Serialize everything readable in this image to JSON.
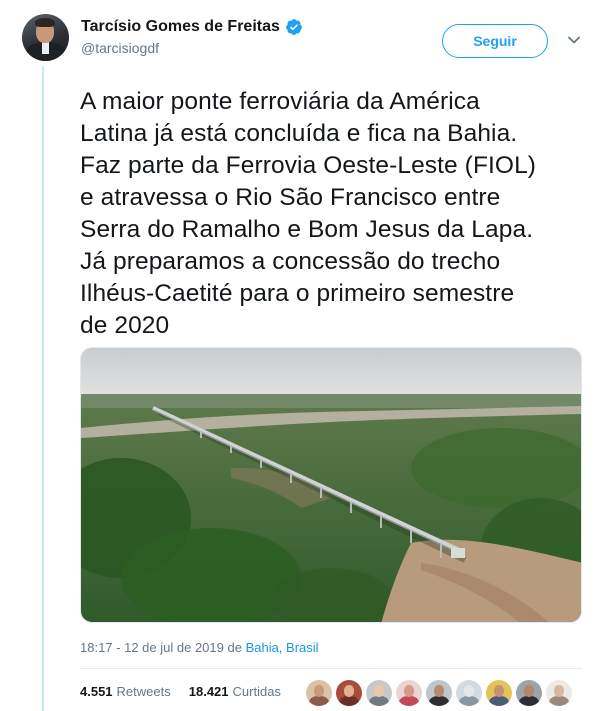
{
  "author": {
    "display_name": "Tarcísio Gomes de Freitas",
    "handle": "@tarcisiogdf",
    "verified": true
  },
  "actions": {
    "follow_label": "Seguir",
    "more_icon": "chevron-down-icon"
  },
  "tweet": {
    "text": "A maior ponte ferroviária da América\nLatina já está concluída e fica na Bahia.\nFaz parte da Ferrovia Oeste-Leste (FIOL)\ne atravessa o Rio São Francisco entre\nSerra do Ramalho e Bom Jesus da Lapa.\nJá preparamos a concessão do trecho\nIlhéus-Caetité para o primeiro semestre\nde 2020",
    "media_description": "aerial-photo-railway-bridge"
  },
  "meta": {
    "time": "18:17",
    "separator": " - ",
    "date": "12 de jul de 2019",
    "location_prefix": " de ",
    "location": "Bahia, Brasil"
  },
  "stats": {
    "retweets_count": "4.551",
    "retweets_label": "Retweets",
    "likes_count": "18.421",
    "likes_label": "Curtidas"
  },
  "likers": [
    {
      "bg": "#d9c2a6",
      "face": "#c79a7a",
      "body": "#8a5c4a"
    },
    {
      "bg": "#a84c3c",
      "face": "#e0b090",
      "body": "#6b2f28"
    },
    {
      "bg": "#c9c9c9",
      "face": "#e7c9ad",
      "body": "#6f7a86"
    },
    {
      "bg": "#e8d6d2",
      "face": "#d79a8a",
      "body": "#c24a5a"
    },
    {
      "bg": "#bfc6cc",
      "face": "#b88a6e",
      "body": "#2d2f33"
    },
    {
      "bg": "#d3dbe2",
      "face": "#e6e6e6",
      "body": "#8c96a0"
    },
    {
      "bg": "#e3c45a",
      "face": "#c89272",
      "body": "#4a5b7a"
    },
    {
      "bg": "#9aa4aa",
      "face": "#b88468",
      "body": "#2a2f35"
    },
    {
      "bg": "#eceae6",
      "face": "#d7b9a0",
      "body": "#9a8a7a"
    }
  ],
  "colors": {
    "accent": "#1da1f2",
    "link": "#1b95e0",
    "verified": "#1da1f2",
    "text": "#14171a",
    "secondary": "#657786"
  }
}
